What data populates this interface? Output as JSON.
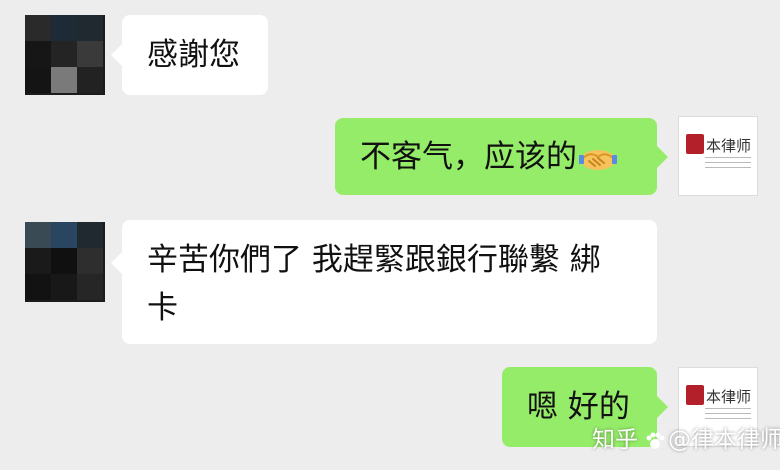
{
  "chat": {
    "messages": [
      {
        "side": "left",
        "text": "感謝您"
      },
      {
        "side": "right",
        "text": "不客气，应该的",
        "emoji": "handshake"
      },
      {
        "side": "left",
        "line1": "辛苦你們了 我趕緊跟銀行聯繫 綁",
        "line2": "卡"
      },
      {
        "side": "right",
        "text": "嗯 好的"
      }
    ]
  },
  "contact_avatar": {
    "icon": "pixelated-avatar"
  },
  "self_avatar": {
    "icon": "law-firm-logo",
    "logo_text": "本律师"
  },
  "watermark": {
    "site": "知乎",
    "account": "@律本律师"
  },
  "colors": {
    "background": "#ededed",
    "incoming_bubble": "#ffffff",
    "outgoing_bubble": "#95ec69",
    "seal": "#b3202a"
  }
}
